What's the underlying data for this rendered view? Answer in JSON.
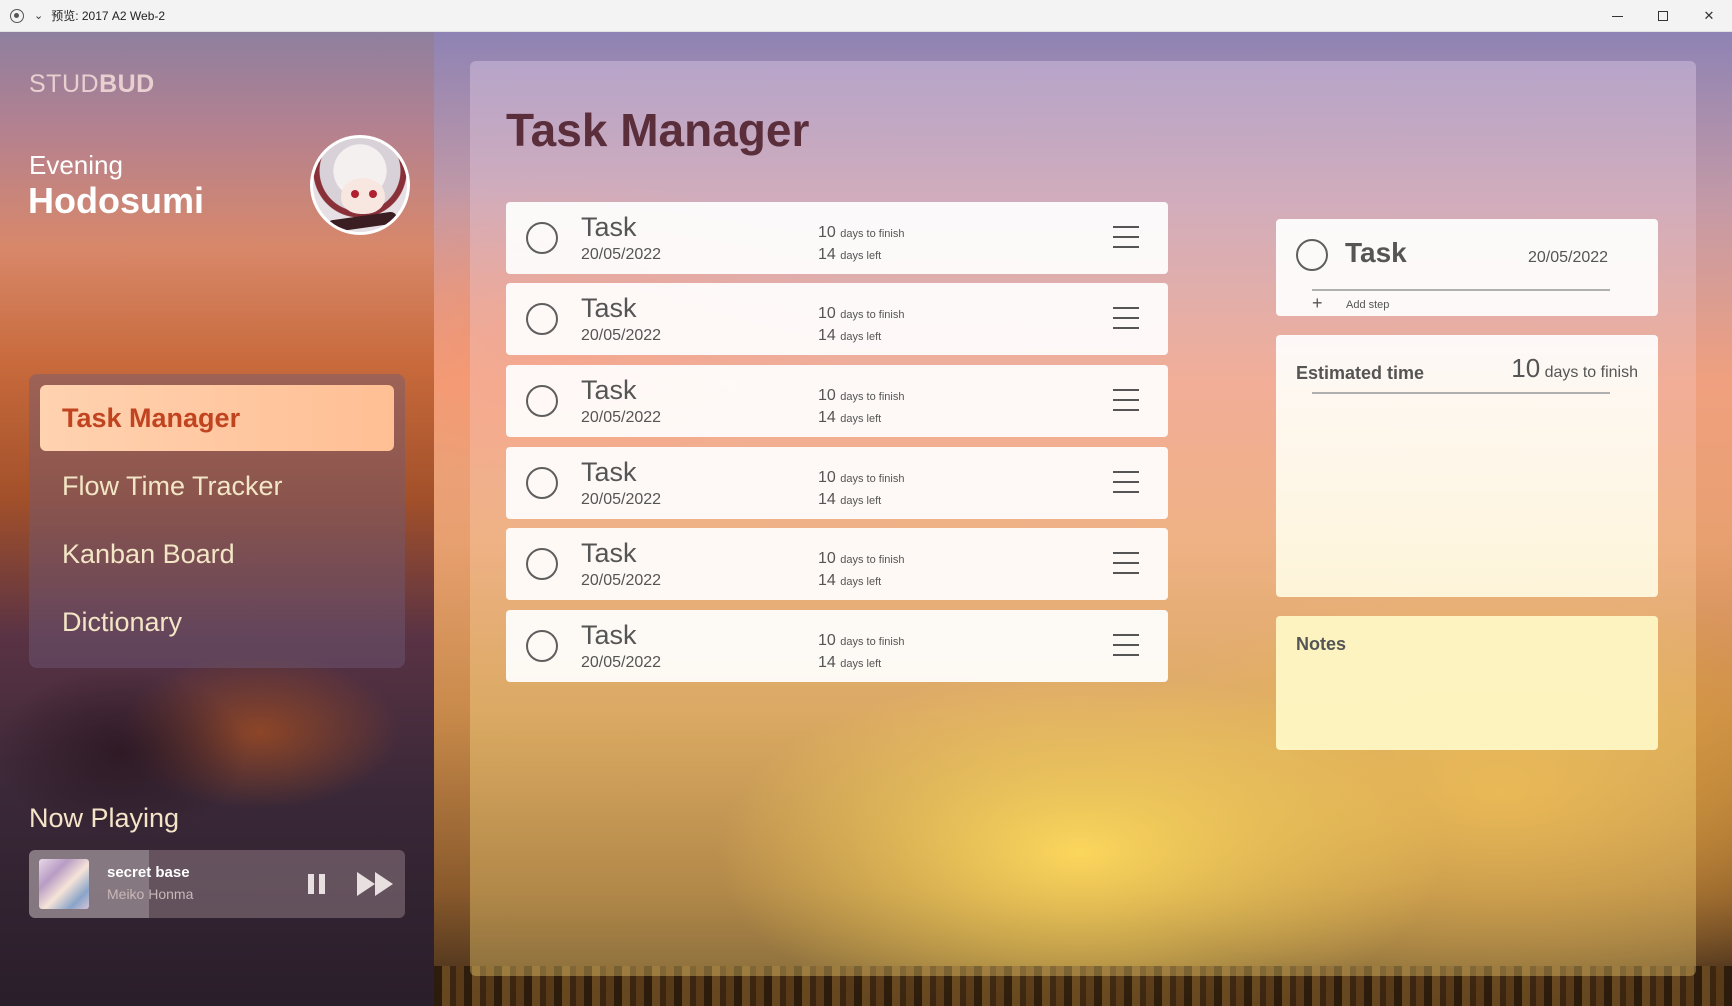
{
  "window": {
    "title": "预览: 2017 A2 Web-2",
    "minimize_label": "",
    "maximize_label": "",
    "close_label": "✕"
  },
  "sidebar": {
    "brand_light": "STUD",
    "brand_bold": "BUD",
    "greeting": "Evening",
    "username": "Hodosumi",
    "nav": [
      {
        "label": "Task Manager",
        "active": true
      },
      {
        "label": "Flow Time Tracker",
        "active": false
      },
      {
        "label": "Kanban Board",
        "active": false
      },
      {
        "label": "Dictionary",
        "active": false
      }
    ],
    "now_playing": {
      "title": "Now Playing",
      "song": "secret base",
      "artist": "Meiko Honma",
      "progress": 0.32
    }
  },
  "main": {
    "title": "Task Manager",
    "tasks": [
      {
        "name": "Task",
        "date": "20/05/2022",
        "finish_num": "10",
        "finish_unit": "days to finish",
        "left_num": "14",
        "left_unit": "days left"
      },
      {
        "name": "Task",
        "date": "20/05/2022",
        "finish_num": "10",
        "finish_unit": "days to finish",
        "left_num": "14",
        "left_unit": "days left"
      },
      {
        "name": "Task",
        "date": "20/05/2022",
        "finish_num": "10",
        "finish_unit": "days to finish",
        "left_num": "14",
        "left_unit": "days left"
      },
      {
        "name": "Task",
        "date": "20/05/2022",
        "finish_num": "10",
        "finish_unit": "days to finish",
        "left_num": "14",
        "left_unit": "days left"
      },
      {
        "name": "Task",
        "date": "20/05/2022",
        "finish_num": "10",
        "finish_unit": "days to finish",
        "left_num": "14",
        "left_unit": "days left"
      },
      {
        "name": "Task",
        "date": "20/05/2022",
        "finish_num": "10",
        "finish_unit": "days to finish",
        "left_num": "14",
        "left_unit": "days left"
      }
    ],
    "detail": {
      "name": "Task",
      "date": "20/05/2022",
      "add_step_icon": "+",
      "add_step": "Add step",
      "estimated_label": "Estimated time",
      "estimated_num": "10",
      "estimated_unit": "days to finish",
      "notes_label": "Notes"
    }
  }
}
